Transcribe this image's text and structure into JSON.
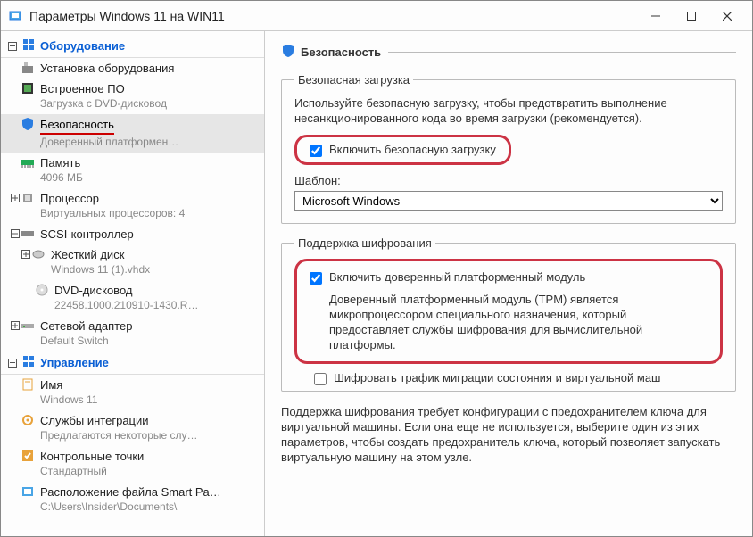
{
  "window": {
    "title": "Параметры Windows 11 на WIN11"
  },
  "sidebar": {
    "hardware_header": "Оборудование",
    "management_header": "Управление",
    "items": {
      "add_hw": {
        "label": "Установка оборудования"
      },
      "firmware": {
        "label": "Встроенное ПО",
        "sub": "Загрузка с DVD-дисковод"
      },
      "security": {
        "label": "Безопасность",
        "sub": "Доверенный платформен…"
      },
      "memory": {
        "label": "Память",
        "sub": "4096 МБ"
      },
      "cpu": {
        "label": "Процессор",
        "sub": "Виртуальных процессоров: 4"
      },
      "scsi": {
        "label": "SCSI-контроллер"
      },
      "hdd": {
        "label": "Жесткий диск",
        "sub": "Windows 11 (1).vhdx"
      },
      "dvd": {
        "label": "DVD-дисковод",
        "sub": "22458.1000.210910-1430.R…"
      },
      "net": {
        "label": "Сетевой адаптер",
        "sub": "Default Switch"
      },
      "name": {
        "label": "Имя",
        "sub": "Windows 11"
      },
      "integration": {
        "label": "Службы интеграции",
        "sub": "Предлагаются некоторые слу…"
      },
      "checkpoints": {
        "label": "Контрольные точки",
        "sub": "Стандартный"
      },
      "smartpaging": {
        "label": "Расположение файла Smart Pa…",
        "sub": "C:\\Users\\Insider\\Documents\\"
      }
    }
  },
  "page": {
    "title": "Безопасность",
    "secure_boot": {
      "legend": "Безопасная загрузка",
      "desc": "Используйте безопасную загрузку, чтобы предотвратить выполнение несанкционированного кода во время загрузки (рекомендуется).",
      "checkbox": "Включить безопасную загрузку",
      "template_label": "Шаблон:",
      "template_value": "Microsoft Windows"
    },
    "encryption": {
      "legend": "Поддержка шифрования",
      "tpm_checkbox": "Включить доверенный платформенный модуль",
      "tpm_desc": "Доверенный платформенный модуль (TPM) является микропроцессором специального назначения, который предоставляет службы шифрования для вычислительной платформы.",
      "encrypt_migration": "Шифровать трафик миграции состояния и виртуальной маш",
      "info": "Поддержка шифрования требует конфигурации с предохранителем ключа для виртуальной машины. Если она еще не используется, выберите один из этих параметров, чтобы создать предохранитель ключа, который позволяет запускать виртуальную машину на этом узле."
    }
  }
}
